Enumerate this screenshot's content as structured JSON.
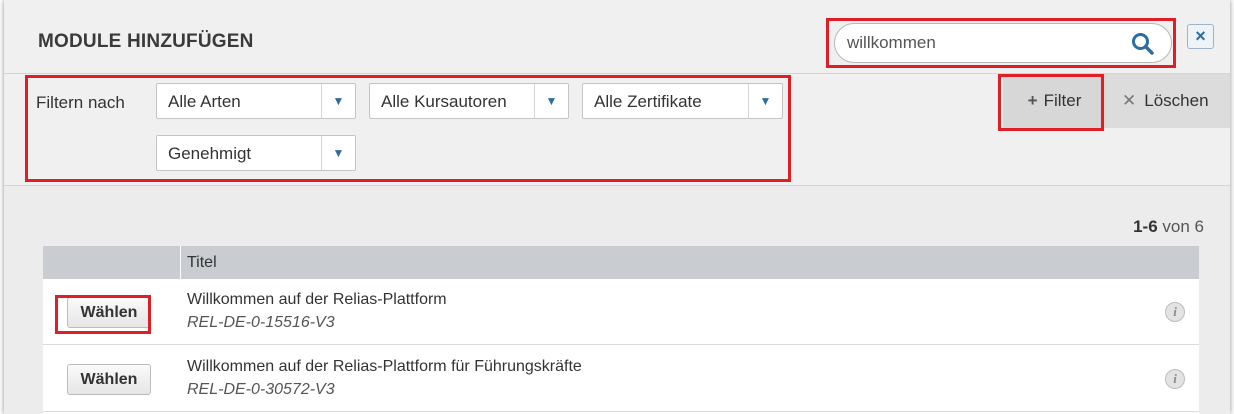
{
  "dialog": {
    "title": "MODULE HINZUFÜGEN",
    "close_glyph": "×"
  },
  "search": {
    "value": "willkommen",
    "icon": "search-icon"
  },
  "filters": {
    "label": "Filtern nach",
    "type_select": "Alle Arten",
    "author_select": "Alle Kursautoren",
    "certificate_select": "Alle Zertifikate",
    "status_select": "Genehmigt",
    "add_filter_label": "Filter",
    "clear_label": "Löschen"
  },
  "results": {
    "range": "1-6",
    "of_total": "von 6"
  },
  "table": {
    "columns": [
      "",
      "Titel"
    ],
    "rows": [
      {
        "button": "Wählen",
        "title": "Willkommen auf der Relias-Plattform",
        "code": "REL-DE-0-15516-V3"
      },
      {
        "button": "Wählen",
        "title": "Willkommen auf der Relias-Plattform für Führungskräfte",
        "code": "REL-DE-0-30572-V3"
      }
    ]
  },
  "colors": {
    "highlight": "#e01e25",
    "accent": "#2e6da4",
    "header_bg": "#f0f0f0",
    "table_header_bg": "#c9ccd0"
  }
}
